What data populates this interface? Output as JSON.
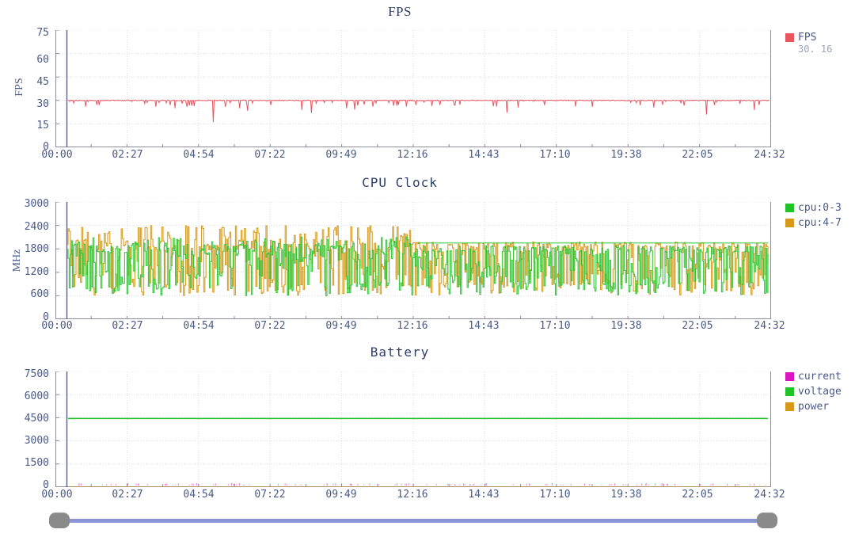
{
  "charts": [
    {
      "id": "fps",
      "title": "FPS",
      "ylabel": "FPS",
      "yticks": [
        "0",
        "15",
        "30",
        "45",
        "60",
        "75"
      ],
      "ylim": [
        0,
        75
      ],
      "legend": [
        {
          "label": "FPS",
          "color": "#e8555f",
          "value": "30. 16"
        }
      ]
    },
    {
      "id": "cpu",
      "title": "CPU Clock",
      "ylabel": "MHz",
      "yticks": [
        "0",
        "600",
        "1200",
        "1800",
        "2400",
        "3000"
      ],
      "ylim": [
        0,
        3000
      ],
      "legend": [
        {
          "label": "cpu:0-3",
          "color": "#22c32a",
          "value": ""
        },
        {
          "label": "cpu:4-7",
          "color": "#d59a1a",
          "value": ""
        }
      ]
    },
    {
      "id": "battery",
      "title": "Battery",
      "ylabel": "",
      "yticks": [
        "0",
        "1500",
        "3000",
        "4500",
        "6000",
        "7500"
      ],
      "ylim": [
        0,
        7500
      ],
      "legend": [
        {
          "label": "current",
          "color": "#d916c0",
          "value": ""
        },
        {
          "label": "voltage",
          "color": "#22c32a",
          "value": ""
        },
        {
          "label": "power",
          "color": "#d59a1a",
          "value": ""
        }
      ]
    }
  ],
  "xticks": [
    "00:00",
    "02:27",
    "04:54",
    "07:22",
    "09:49",
    "12:16",
    "14:43",
    "17:10",
    "19:38",
    "22:05",
    "24:32"
  ],
  "colors": {
    "axis_text": "#4a5a86",
    "title": "#2c3e6b",
    "grid": "#dcdcdc",
    "axis_line": "#8d8d9e",
    "cursor": "#5a5f80",
    "slider_track": "#8a93d4",
    "slider_handle": "#8a8a8a"
  },
  "chart_data": [
    {
      "type": "line",
      "title": "FPS",
      "xlabel": "",
      "ylabel": "FPS",
      "ylim": [
        0,
        75
      ],
      "xlim": [
        "00:00",
        "24:32"
      ],
      "grid": true,
      "legend_position": "right",
      "categories": [
        "00:00",
        "02:27",
        "04:54",
        "07:22",
        "09:49",
        "12:16",
        "14:43",
        "17:10",
        "19:38",
        "22:05",
        "24:32"
      ],
      "series": [
        {
          "name": "FPS",
          "color": "#e8555f",
          "current_value": 30.16,
          "baseline": 30,
          "notes": "Flat near 30 fps with frequent small downward spikes; notable deep drops to ~16 near 05:05, ~22 near 08:30, ~21 near 22:20.",
          "dips": [
            {
              "x": "01:05",
              "y": 27
            },
            {
              "x": "02:40",
              "y": 28
            },
            {
              "x": "03:05",
              "y": 26
            },
            {
              "x": "03:35",
              "y": 27
            },
            {
              "x": "04:10",
              "y": 26
            },
            {
              "x": "05:05",
              "y": 16
            },
            {
              "x": "06:00",
              "y": 25
            },
            {
              "x": "07:05",
              "y": 27
            },
            {
              "x": "08:30",
              "y": 22
            },
            {
              "x": "09:45",
              "y": 25
            },
            {
              "x": "10:40",
              "y": 26
            },
            {
              "x": "12:10",
              "y": 27
            },
            {
              "x": "13:30",
              "y": 27
            },
            {
              "x": "15:00",
              "y": 26
            },
            {
              "x": "16:40",
              "y": 27
            },
            {
              "x": "18:20",
              "y": 26
            },
            {
              "x": "20:00",
              "y": 27
            },
            {
              "x": "22:20",
              "y": 21
            },
            {
              "x": "23:30",
              "y": 28
            }
          ]
        }
      ]
    },
    {
      "type": "line",
      "title": "CPU Clock",
      "xlabel": "",
      "ylabel": "MHz",
      "ylim": [
        0,
        3000
      ],
      "xlim": [
        "00:00",
        "24:32"
      ],
      "grid": true,
      "legend_position": "right",
      "categories": [
        "00:00",
        "02:27",
        "04:54",
        "07:22",
        "09:49",
        "12:16",
        "14:43",
        "17:10",
        "19:38",
        "22:05",
        "24:32"
      ],
      "series": [
        {
          "name": "cpu:0-3",
          "color": "#22c32a",
          "min": 600,
          "max": 2100,
          "typical": 1800,
          "notes": "Highly oscillatory little cores; dense vertical swings between ~600 and ~2000 MHz, settling around 1900 MHz plateau after 12:16."
        },
        {
          "name": "cpu:4-7",
          "color": "#d59a1a",
          "min": 600,
          "max": 2400,
          "typical": 1900,
          "notes": "Big cores oscillate between ~650 and ~2400 MHz; peaks to 2400 early in the trace, plateau near 2000 MHz after 12:16."
        }
      ]
    },
    {
      "type": "line",
      "title": "Battery",
      "xlabel": "",
      "ylabel": "",
      "ylim": [
        0,
        7500
      ],
      "xlim": [
        "00:00",
        "24:32"
      ],
      "grid": true,
      "legend_position": "right",
      "categories": [
        "00:00",
        "02:27",
        "04:54",
        "07:22",
        "09:49",
        "12:16",
        "14:43",
        "17:10",
        "19:38",
        "22:05",
        "24:32"
      ],
      "series": [
        {
          "name": "current",
          "color": "#d916c0",
          "typical": 30,
          "notes": "Near zero throughout, faint dotted marks along baseline."
        },
        {
          "name": "voltage",
          "color": "#22c32a",
          "typical": 4450,
          "notes": "Essentially flat horizontal line slightly below the 4500 gridline."
        },
        {
          "name": "power",
          "color": "#d59a1a",
          "typical": 20,
          "notes": "Near zero throughout, hidden along baseline."
        }
      ]
    }
  ],
  "slider": {
    "left_handle": "range-start-handle",
    "right_handle": "range-end-handle",
    "position_left_pct": 0,
    "position_right_pct": 100
  }
}
